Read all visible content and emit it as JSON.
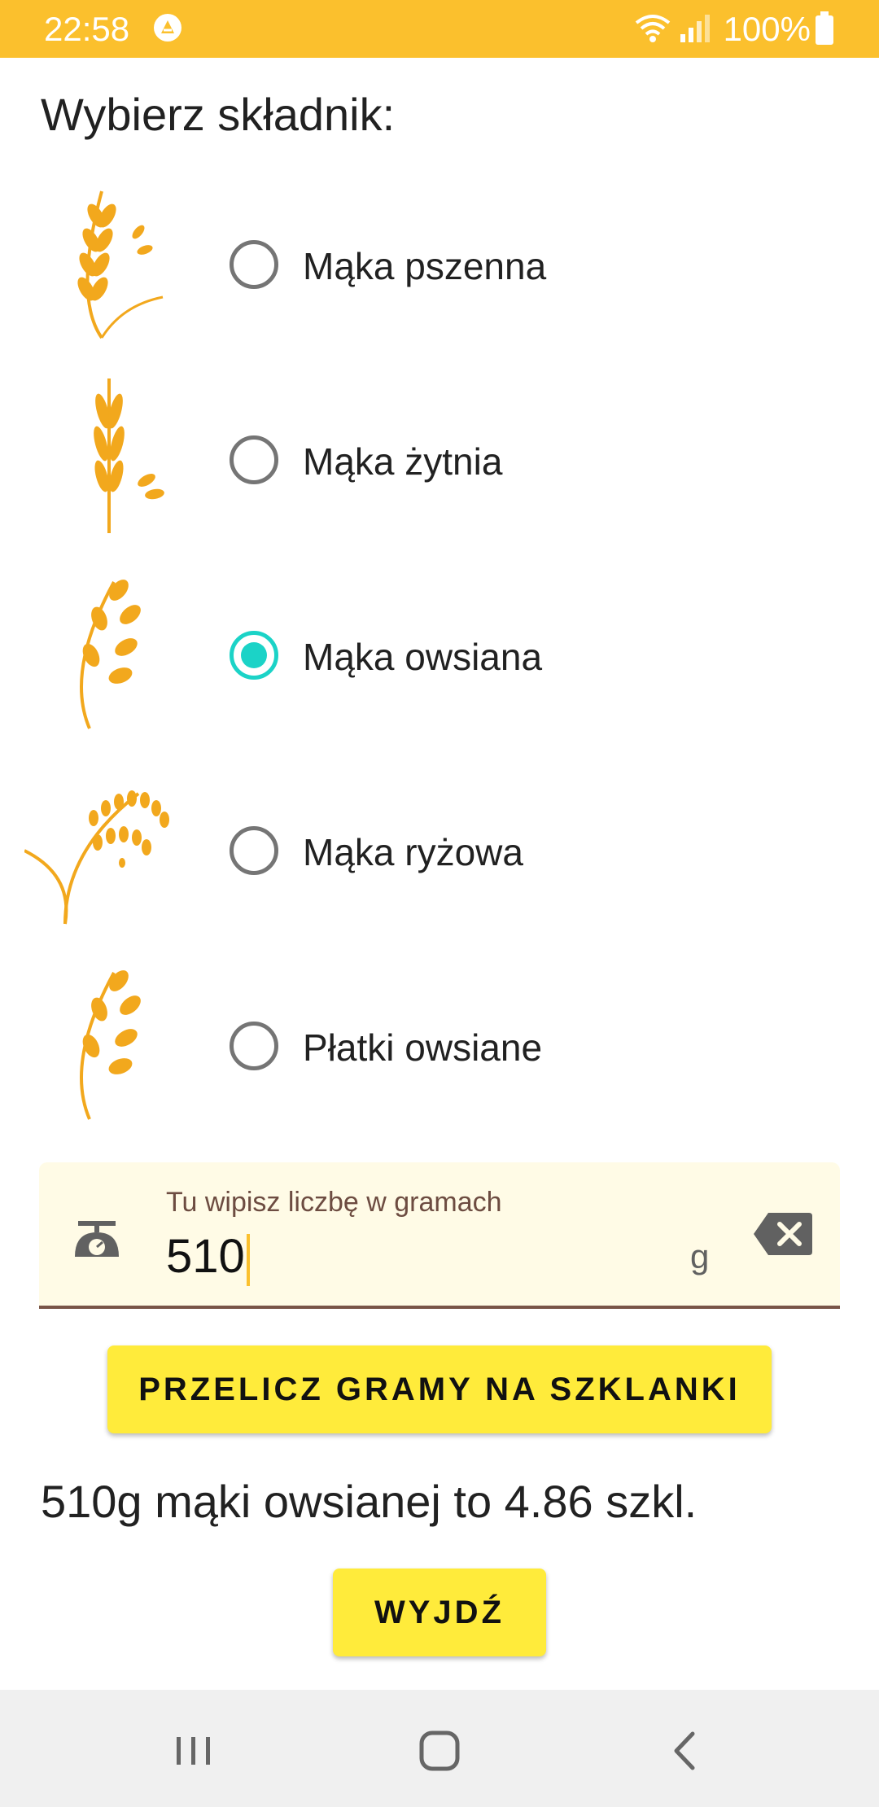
{
  "status_bar": {
    "time": "22:58",
    "battery": "100%"
  },
  "heading": "Wybierz składnik:",
  "options": [
    {
      "label": "Mąka pszenna",
      "grain_text": "Wheat",
      "checked": false
    },
    {
      "label": "Mąka żytnia",
      "grain_text": "Rye",
      "checked": false
    },
    {
      "label": "Mąka owsiana",
      "grain_text": "Oats",
      "checked": true
    },
    {
      "label": "Mąka ryżowa",
      "grain_text": "Rice",
      "checked": false
    },
    {
      "label": "Płatki owsiane",
      "grain_text": "Oats",
      "checked": false
    }
  ],
  "grams_input": {
    "label": "Tu wipisz liczbę w gramach",
    "value": "510",
    "suffix": "g"
  },
  "convert_button": "PRZELICZ GRAMY NA SZKLANKI",
  "result": "510g mąki owsianej to 4.86 szkl.",
  "exit_button": "WYJDŹ",
  "colors": {
    "accent": "#fbc02d",
    "radio_selected": "#1bd3c7",
    "button": "#ffeb3b",
    "input_background": "#fffbe6",
    "input_underline": "#795548"
  }
}
